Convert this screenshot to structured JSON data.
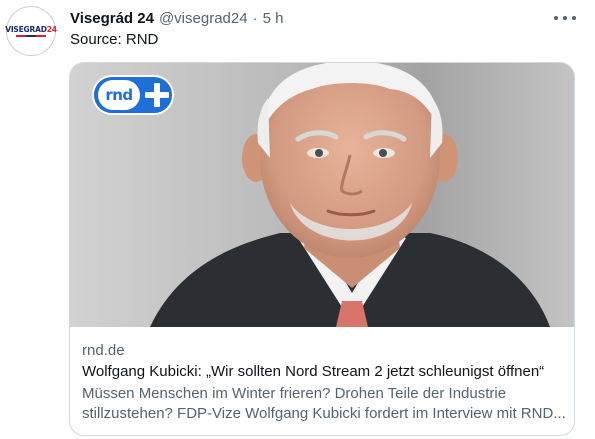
{
  "author": {
    "name": "Visegrád 24",
    "handle": "@visegrad24",
    "separator": "·",
    "time": "5 h",
    "avatar_text": "VISEGRAD",
    "avatar_text_accent": "24"
  },
  "tweet": {
    "text": "Source: RND"
  },
  "card": {
    "badge_text": "rnd",
    "domain": "rnd.de",
    "title": "Wolfgang Kubicki: „Wir sollten Nord Stream 2 jetzt schleunigst öffnen“",
    "description": "Müssen Menschen im Winter frieren? Drohen Teile der Industrie stillzustehen? FDP-Vize Wolfgang Kubicki fordert im Interview mit RND..."
  },
  "icons": {
    "more": "more-horizontal-icon",
    "badge_plus": "plus-icon"
  },
  "colors": {
    "text_primary": "#0f1419",
    "text_secondary": "#536471",
    "border": "#cfd9de",
    "rnd_blue": "#1f6fd8"
  }
}
